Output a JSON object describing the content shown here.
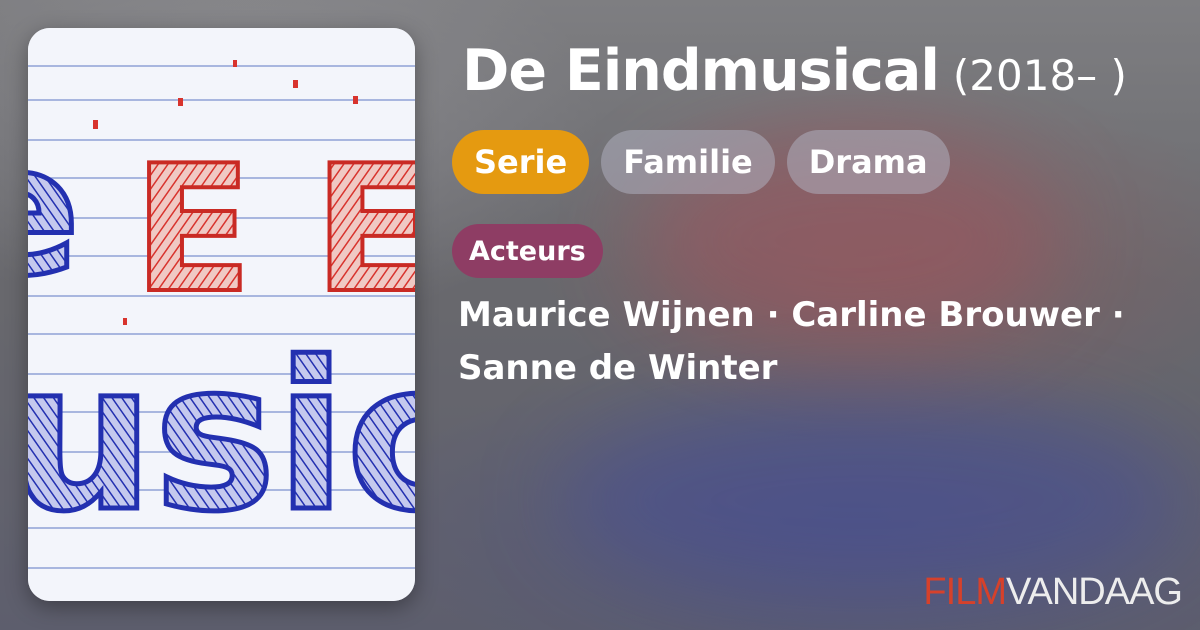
{
  "title": "De Eindmusical",
  "year": "(2018– )",
  "tags": [
    {
      "label": "Serie",
      "color": "#e59a10"
    },
    {
      "label": "Familie"
    },
    {
      "label": "Drama"
    }
  ],
  "actors_section": {
    "label": "Acteurs",
    "line1": "Maurice Wijnen · Carline Brouwer ·",
    "line2": "Sanne de Winter"
  },
  "brand": {
    "part1": "FILM",
    "part2": "VANDAAG"
  },
  "poster": {
    "text_red": "E EI",
    "text_blue": "usic",
    "text_left": "e"
  },
  "colors": {
    "accent": "#e59a10",
    "badge": "#8e3d64",
    "brand_red": "#d6412b"
  }
}
